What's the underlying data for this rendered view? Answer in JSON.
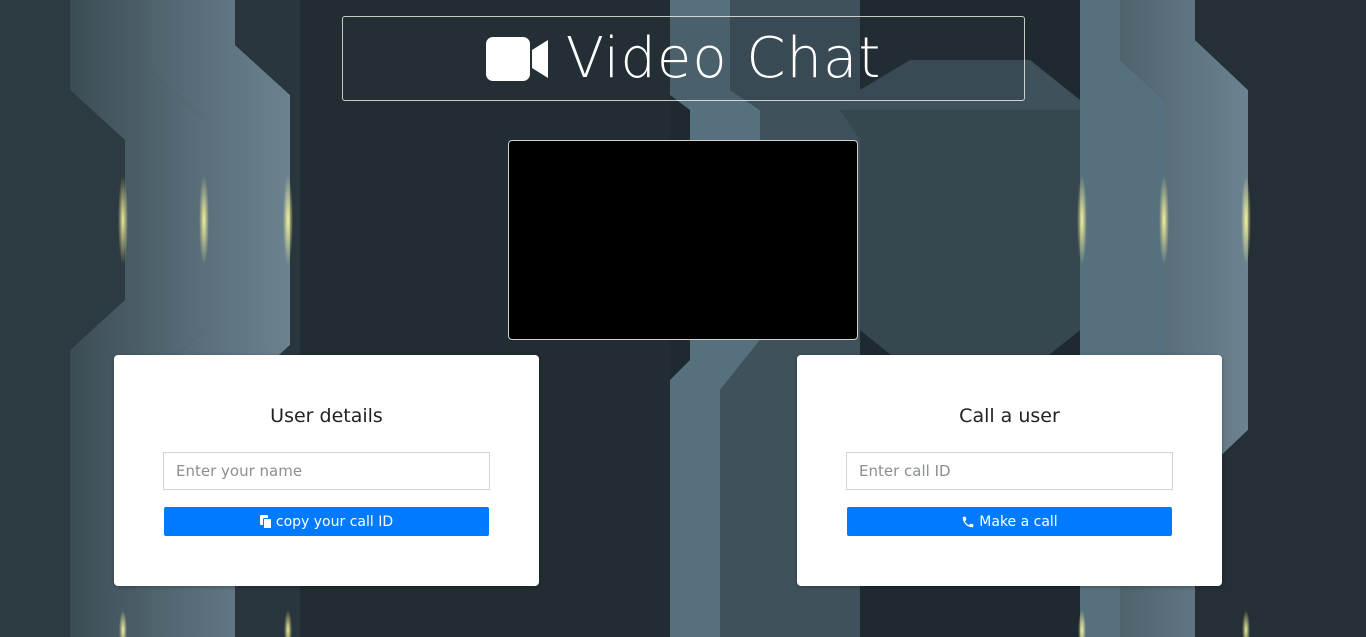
{
  "header": {
    "title": "Video Chat",
    "icon": "video-camera-icon"
  },
  "user_details": {
    "heading": "User details",
    "name_placeholder": "Enter your name",
    "name_value": "",
    "copy_button_label": "copy your call ID",
    "copy_icon": "copy-icon"
  },
  "call_user": {
    "heading": "Call a user",
    "call_id_placeholder": "Enter call ID",
    "call_id_value": "",
    "call_button_label": "Make a call",
    "call_icon": "phone-icon"
  },
  "colors": {
    "primary_button": "#007bff",
    "background_dark": "#1f2a30",
    "accent_glow": "#f5f07a",
    "video_bg": "#000000"
  }
}
